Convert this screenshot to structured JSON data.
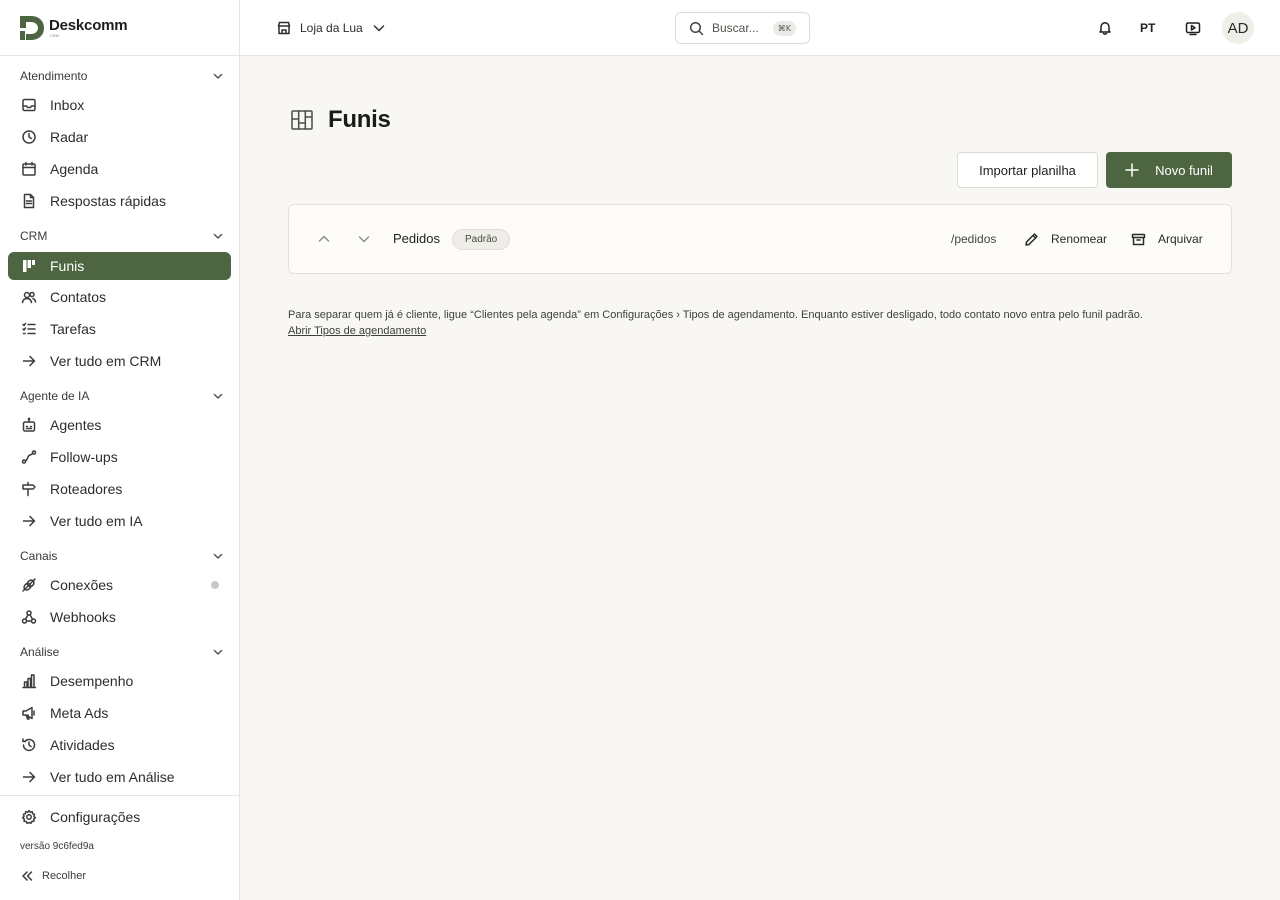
{
  "app": {
    "logo_text": "Deskcomm",
    "logo_sub": "CRM"
  },
  "sidebar": {
    "sections": [
      {
        "title": "Atendimento",
        "items": [
          {
            "label": "Inbox",
            "icon": "inbox-icon"
          },
          {
            "label": "Radar",
            "icon": "radar-icon"
          },
          {
            "label": "Agenda",
            "icon": "calendar-icon"
          },
          {
            "label": "Respostas rápidas",
            "icon": "document-icon"
          }
        ]
      },
      {
        "title": "CRM",
        "items": [
          {
            "label": "Funis",
            "icon": "kanban-icon",
            "active": true
          },
          {
            "label": "Contatos",
            "icon": "users-icon"
          },
          {
            "label": "Tarefas",
            "icon": "checklist-icon"
          },
          {
            "label": "Ver tudo em CRM",
            "icon": "arrow-right-icon"
          }
        ]
      },
      {
        "title": "Agente de IA",
        "items": [
          {
            "label": "Agentes",
            "icon": "bot-icon"
          },
          {
            "label": "Follow-ups",
            "icon": "route-icon"
          },
          {
            "label": "Roteadores",
            "icon": "signpost-icon"
          },
          {
            "label": "Ver tudo em IA",
            "icon": "arrow-right-icon"
          }
        ]
      },
      {
        "title": "Canais",
        "items": [
          {
            "label": "Conexões",
            "icon": "plug-off-icon",
            "status": "inactive"
          },
          {
            "label": "Webhooks",
            "icon": "webhook-icon"
          }
        ]
      },
      {
        "title": "Análise",
        "items": [
          {
            "label": "Desempenho",
            "icon": "bar-chart-icon"
          },
          {
            "label": "Meta Ads",
            "icon": "megaphone-icon"
          },
          {
            "label": "Atividades",
            "icon": "history-icon"
          },
          {
            "label": "Ver tudo em Análise",
            "icon": "arrow-right-icon"
          }
        ]
      }
    ],
    "settings_label": "Configurações",
    "version": "versão 9c6fed9a",
    "collapse_label": "Recolher"
  },
  "topbar": {
    "store_name": "Loja da Lua",
    "search_placeholder": "Buscar...",
    "search_shortcut": "⌘K",
    "language": "PT",
    "avatar_initials": "AD"
  },
  "page": {
    "title": "Funis",
    "import_button": "Importar planilha",
    "new_button": "Novo funil"
  },
  "funnels": [
    {
      "name": "Pedidos",
      "badge": "Padrão",
      "slug": "/pedidos",
      "rename_label": "Renomear",
      "archive_label": "Arquivar"
    }
  ],
  "help": {
    "text": "Para separar quem já é cliente, ligue “Clientes pela agenda” em Configurações › Tipos de agendamento. Enquanto estiver desligado, todo contato novo entra pelo funil padrão.",
    "link": "Abrir Tipos de agendamento"
  },
  "colors": {
    "accent": "#4d6641",
    "background": "#f8f7f3",
    "sidebar": "#ffffff"
  }
}
